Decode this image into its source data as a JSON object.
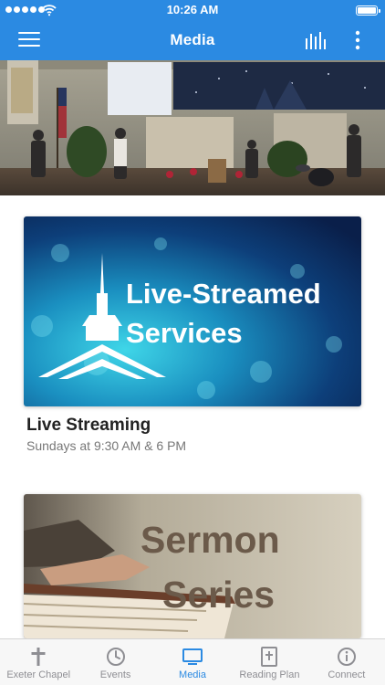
{
  "status_bar": {
    "time": "10:26 AM"
  },
  "header": {
    "title": "Media"
  },
  "content": {
    "cards": [
      {
        "image_title_line1": "Live-Streamed",
        "image_title_line2": "Services",
        "title": "Live Streaming",
        "subtitle": "Sundays at 9:30 AM & 6 PM"
      },
      {
        "image_title_line1": "Sermon",
        "image_title_line2": "Series"
      }
    ]
  },
  "tabs": [
    {
      "label": "Exeter Chapel",
      "icon": "cross-icon"
    },
    {
      "label": "Events",
      "icon": "clock-icon"
    },
    {
      "label": "Media",
      "icon": "tv-icon",
      "active": true
    },
    {
      "label": "Reading Plan",
      "icon": "bible-icon"
    },
    {
      "label": "Connect",
      "icon": "info-icon"
    }
  ],
  "colors": {
    "accent": "#2b8ae2",
    "tab_inactive": "#8e8e93"
  }
}
